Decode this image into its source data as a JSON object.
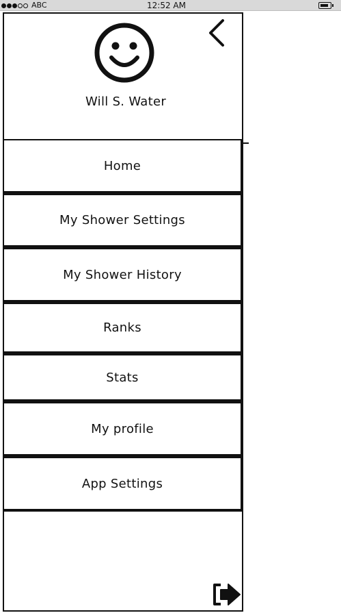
{
  "status_bar": {
    "carrier": "ABC",
    "time": "12:52 AM"
  },
  "drawer": {
    "user_name": "Will S. Water",
    "menu": [
      {
        "id": "home",
        "label": "Home"
      },
      {
        "id": "shower-settings",
        "label": "My Shower Settings"
      },
      {
        "id": "shower-history",
        "label": "My Shower History"
      },
      {
        "id": "ranks",
        "label": "Ranks"
      },
      {
        "id": "stats",
        "label": "Stats"
      },
      {
        "id": "profile",
        "label": "My profile"
      },
      {
        "id": "app-settings",
        "label": "App Settings"
      }
    ]
  },
  "icons": {
    "back": "chevron-left-icon",
    "avatar": "smiley-face-icon",
    "logout": "logout-icon"
  }
}
